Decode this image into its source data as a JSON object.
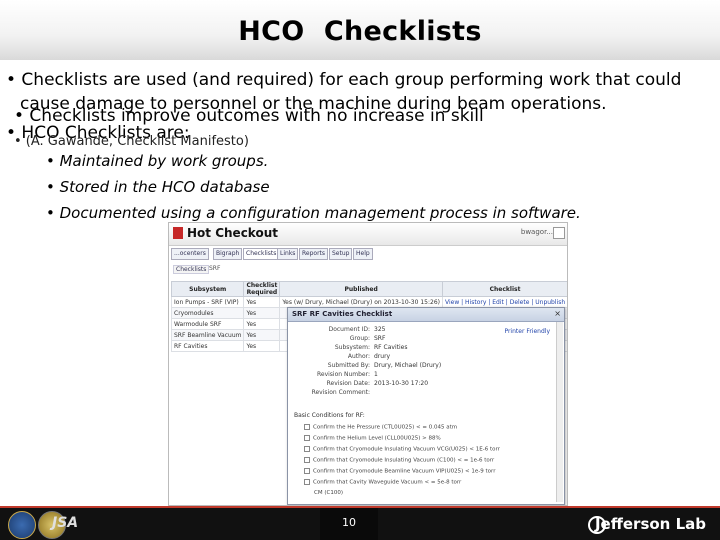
{
  "title": "HCO  Checklists",
  "bullets": {
    "b1_line1": "• Checklists are used (and required) for each group performing work that could",
    "b1_line2": "cause damage to personnel or the machine during beam operations.",
    "b2": "• Checklists improve outcomes with no increase in skill",
    "b3": "• HCO Checklists are:",
    "b2_note": "• (A. Gawande, Checklist Manifesto)",
    "sub": [
      "•  Maintained by work groups.",
      "•  Stored in the HCO database",
      "•  Documented using a configuration management process in software."
    ]
  },
  "screenshot": {
    "app_title": "Hot Checkout",
    "user_label": "bwagor...",
    "tabs": [
      "...ocenters",
      "Bigraph",
      "Checklists",
      "Links",
      "Reports",
      "Setup",
      "Help"
    ],
    "crumb": "Checklists",
    "crumb_sub": "SRF",
    "table_headers": [
      "Subsystem",
      "Checklist Required",
      "Published",
      "Checklist"
    ],
    "table_rows": [
      [
        "Ion Pumps - SRF (VIP)",
        "Yes",
        "Yes (w/ Drury, Michael (Drury) on 2013-10-30 15:26)",
        "View | History | Edit | Delete | Unpublish"
      ],
      [
        "Cryomodules",
        "Yes",
        "",
        ""
      ],
      [
        "Warmodule SRF",
        "Yes",
        "",
        ""
      ],
      [
        "SRF Beamline Vacuum",
        "Yes",
        "",
        ""
      ],
      [
        "RF Cavities",
        "Yes",
        "",
        ""
      ]
    ],
    "popup": {
      "title": "SRF RF Cavities Checklist",
      "printer": "Printer Friendly",
      "fields": [
        {
          "k": "Document ID:",
          "v": "325"
        },
        {
          "k": "Group:",
          "v": "SRF"
        },
        {
          "k": "Subsystem:",
          "v": "RF Cavities"
        },
        {
          "k": "Author:",
          "v": "drury"
        },
        {
          "k": "Submitted By:",
          "v": "Drury, Michael (Drury)"
        },
        {
          "k": "Revision Number:",
          "v": "1"
        },
        {
          "k": "Revision Date:",
          "v": "2013-10-30 17:20"
        },
        {
          "k": "Revision Comment:",
          "v": ""
        }
      ],
      "section": "Basic Conditions for RF:",
      "checks": [
        "Confirm the He Pressure (CTL0U025) < = 0.045 atm",
        "Confirm the Helium Level (CLL00U025) > 88%",
        "Confirm that Cryomodule Insulating Vacuum VCG(U025) < 1E-6 torr",
        "Confirm that Cryomodule Insulating Vacuum (C100) < = 1e-6 torr",
        "Confirm that Cryomodule Beamline Vacuum VIP(U025) < 1e-9 torr",
        "Confirm that Cavity Waveguide Vacuum < = 5e-8 torr",
        "CM (C100)"
      ]
    }
  },
  "footer": {
    "page_number": "10",
    "lab_name": "Jefferson Lab",
    "jsa": "JSA"
  }
}
